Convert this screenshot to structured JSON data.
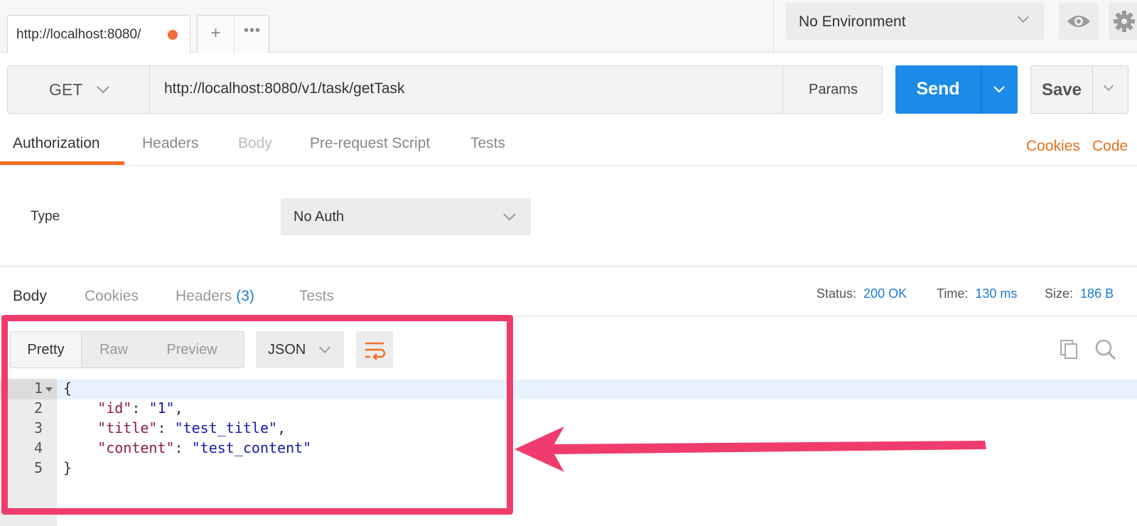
{
  "tabs": {
    "active_label": "http://localhost:8080/",
    "new_tab_glyph": "+",
    "more_glyph": "•••"
  },
  "environment": {
    "selected": "No Environment"
  },
  "request": {
    "method": "GET",
    "url": "http://localhost:8080/v1/task/getTask",
    "params_label": "Params",
    "send_label": "Send",
    "save_label": "Save"
  },
  "request_tabs": {
    "authorization": "Authorization",
    "headers": "Headers",
    "body": "Body",
    "pre_request": "Pre-request Script",
    "tests": "Tests",
    "cookies": "Cookies",
    "code": "Code"
  },
  "auth": {
    "type_label": "Type",
    "type_value": "No Auth"
  },
  "response_tabs": {
    "body": "Body",
    "cookies": "Cookies",
    "headers": "Headers",
    "headers_count": "(3)",
    "tests": "Tests"
  },
  "response_meta": {
    "status_label": "Status:",
    "status_value": "200 OK",
    "time_label": "Time:",
    "time_value": "130 ms",
    "size_label": "Size:",
    "size_value": "186 B"
  },
  "viewer": {
    "pretty": "Pretty",
    "raw": "Raw",
    "preview": "Preview",
    "language": "JSON"
  },
  "code_lines": [
    {
      "num": "1",
      "parts": [
        "{"
      ]
    },
    {
      "num": "2",
      "key": "\"id\"",
      "sep": ": ",
      "val": "\"1\"",
      "end": ","
    },
    {
      "num": "3",
      "key": "\"title\"",
      "sep": ": ",
      "val": "\"test_title\"",
      "end": ","
    },
    {
      "num": "4",
      "key": "\"content\"",
      "sep": ": ",
      "val": "\"test_content\"",
      "end": ""
    },
    {
      "num": "5",
      "parts": [
        "}"
      ]
    }
  ],
  "colors": {
    "accent_orange": "#f47023",
    "send_blue": "#1a8be8",
    "annotation_pink": "#f03c6c"
  }
}
